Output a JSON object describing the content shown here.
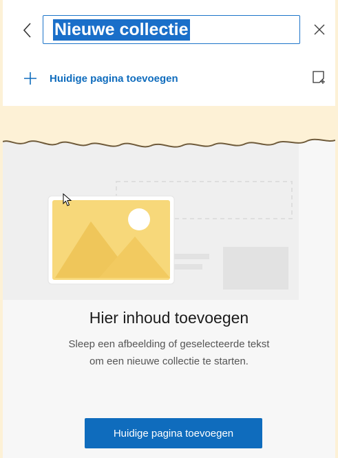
{
  "header": {
    "collection_title": "Nieuwe collectie",
    "add_current_page_label": "Huidige pagina toevoegen"
  },
  "icons": {
    "back": "chevron-left-icon",
    "close": "close-icon",
    "add": "plus-icon",
    "add_note": "add-note-icon",
    "cursor": "mouse-pointer-icon"
  },
  "empty_state": {
    "heading": "Hier inhoud toevoegen",
    "description": "Sleep een afbeelding of geselecteerde tekst om een nieuwe collectie te starten.",
    "button_label": "Huidige pagina toevoegen"
  },
  "colors": {
    "accent": "#0f6cbd",
    "selection": "#1a6fc9",
    "outer_background": "#fdf1d6",
    "image_card_yellow": "#f7d87a"
  }
}
